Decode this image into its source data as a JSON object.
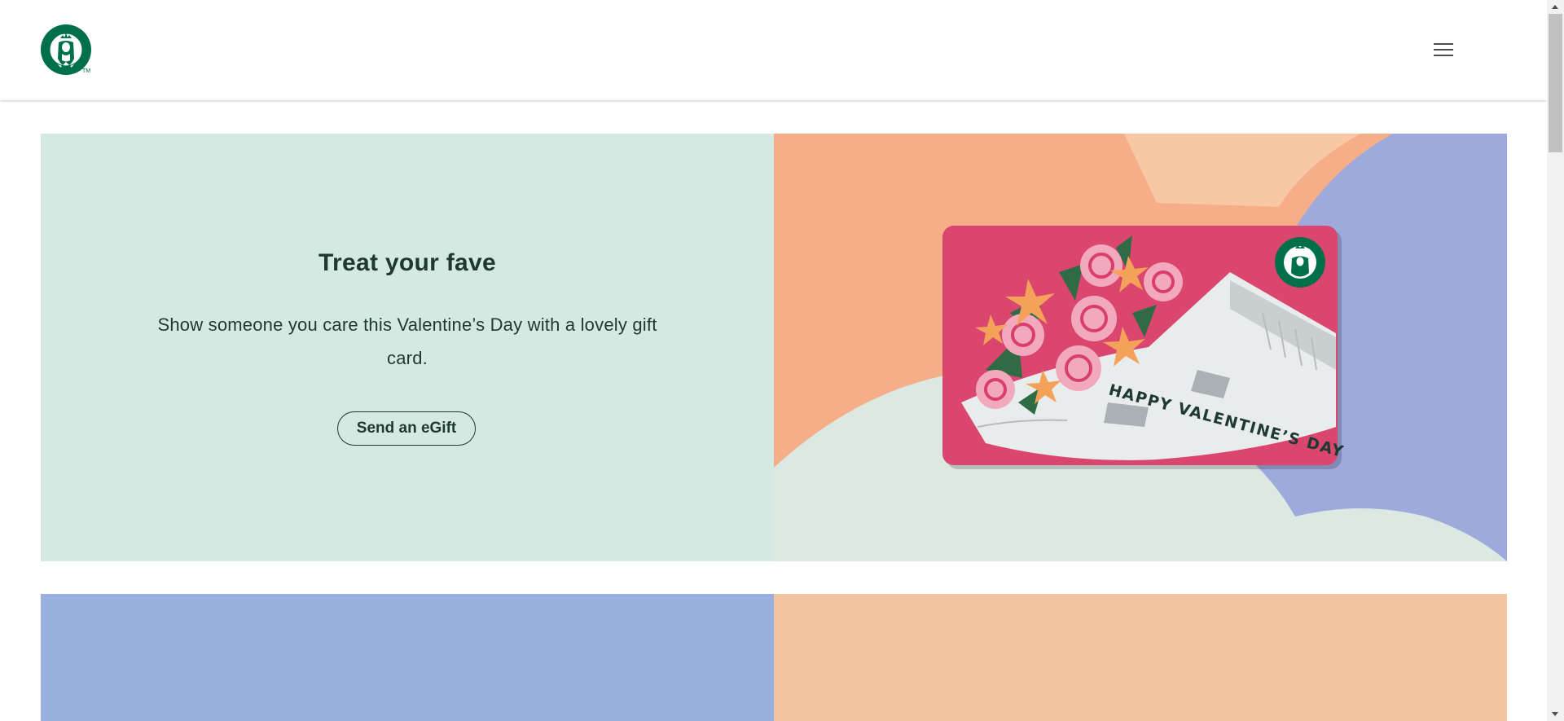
{
  "header": {
    "logo_label": "Starbucks",
    "logo_tm": "TM",
    "menu_icon": "hamburger-menu-icon"
  },
  "hero": {
    "title": "Treat your fave",
    "body": "Show someone you care this Valentine’s Day with a lovely gift card.",
    "cta_label": "Send an eGift",
    "panel_color": "#d4e9e2",
    "card_text": "HAPPY VALENTINE’S DAY"
  },
  "row2": {
    "left_color": "#99b0df",
    "right_color": "#f2c4a0"
  },
  "colors": {
    "brand_green": "#00704a",
    "house_green": "#1e3932",
    "card_pink": "#d93f6a",
    "peach": "#f6ae89",
    "periwinkle": "#9ea9dc"
  }
}
